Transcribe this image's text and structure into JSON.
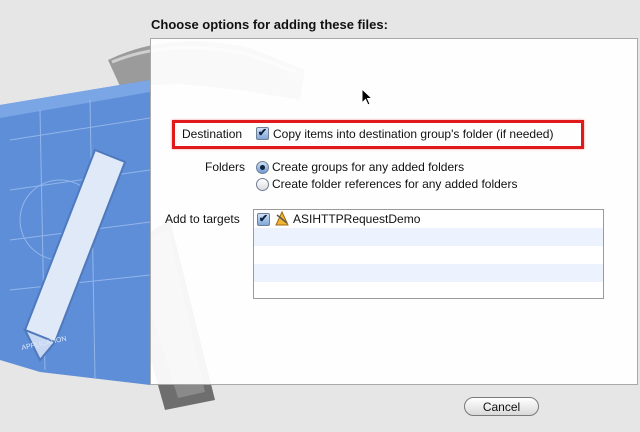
{
  "sheet": {
    "title": "Choose options for adding these files:"
  },
  "destination": {
    "label": "Destination",
    "checkbox_label": "Copy items into destination group's folder (if needed)",
    "checked": true
  },
  "folders": {
    "label": "Folders",
    "options": [
      {
        "label": "Create groups for any added folders",
        "selected": true
      },
      {
        "label": "Create folder references for any added folders",
        "selected": false
      }
    ]
  },
  "targets": {
    "label": "Add to targets",
    "items": [
      {
        "name": "ASIHTTPRequestDemo",
        "checked": true,
        "icon": "app-target-icon"
      }
    ]
  },
  "buttons": {
    "cancel": "Cancel"
  },
  "colors": {
    "highlight": "#e0191b",
    "list_alt_row": "#edf3fe"
  }
}
